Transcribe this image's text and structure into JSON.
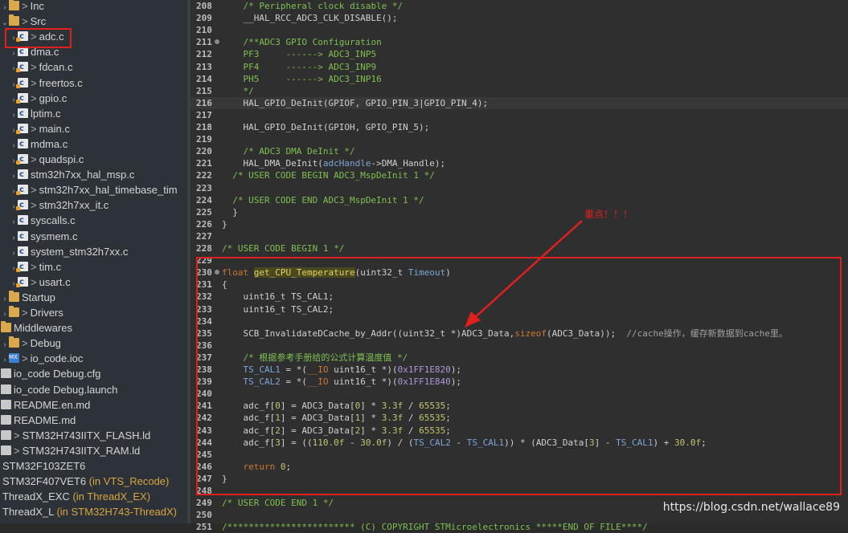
{
  "explorer": {
    "items": [
      {
        "chev": "›",
        "icon": "folder",
        "gt": true,
        "label": "Inc",
        "indent": 0
      },
      {
        "chev": "⌄",
        "icon": "folder",
        "gt": true,
        "label": "Src",
        "indent": 0
      },
      {
        "chev": "›",
        "icon": "cfile",
        "gt": true,
        "label": "adc.c",
        "indent": 1,
        "mod": true
      },
      {
        "chev": "›",
        "icon": "cfile",
        "gt": false,
        "label": "dma.c",
        "indent": 1
      },
      {
        "chev": "›",
        "icon": "cfile",
        "gt": true,
        "label": "fdcan.c",
        "indent": 1,
        "mod": true
      },
      {
        "chev": "›",
        "icon": "cfile",
        "gt": true,
        "label": "freertos.c",
        "indent": 1,
        "mod": true
      },
      {
        "chev": "›",
        "icon": "cfile",
        "gt": true,
        "label": "gpio.c",
        "indent": 1,
        "mod": true
      },
      {
        "chev": "›",
        "icon": "cfile",
        "gt": false,
        "label": "lptim.c",
        "indent": 1
      },
      {
        "chev": "›",
        "icon": "cfile",
        "gt": true,
        "label": "main.c",
        "indent": 1,
        "mod": true
      },
      {
        "chev": "›",
        "icon": "cfile",
        "gt": false,
        "label": "mdma.c",
        "indent": 1
      },
      {
        "chev": "›",
        "icon": "cfile",
        "gt": true,
        "label": "quadspi.c",
        "indent": 1,
        "mod": true
      },
      {
        "chev": "›",
        "icon": "cfile",
        "gt": false,
        "label": "stm32h7xx_hal_msp.c",
        "indent": 1
      },
      {
        "chev": "›",
        "icon": "cfile",
        "gt": true,
        "label": "stm32h7xx_hal_timebase_tim",
        "indent": 1,
        "mod": true
      },
      {
        "chev": "›",
        "icon": "cfile",
        "gt": true,
        "label": "stm32h7xx_it.c",
        "indent": 1,
        "mod": true
      },
      {
        "chev": "›",
        "icon": "cfile",
        "gt": false,
        "label": "syscalls.c",
        "indent": 1
      },
      {
        "chev": "›",
        "icon": "cfile",
        "gt": false,
        "label": "sysmem.c",
        "indent": 1
      },
      {
        "chev": "›",
        "icon": "cfile",
        "gt": false,
        "label": "system_stm32h7xx.c",
        "indent": 1
      },
      {
        "chev": "›",
        "icon": "cfile",
        "gt": true,
        "label": "tim.c",
        "indent": 1,
        "mod": true
      },
      {
        "chev": "›",
        "icon": "cfile",
        "gt": true,
        "label": "usart.c",
        "indent": 1,
        "mod": true
      },
      {
        "chev": "›",
        "icon": "folder",
        "gt": false,
        "label": "Startup",
        "indent": 0
      },
      {
        "chev": "›",
        "icon": "folder",
        "gt": true,
        "label": "Drivers",
        "indent": -1
      },
      {
        "chev": "",
        "icon": "folder",
        "gt": false,
        "label": "Middlewares",
        "indent": -2
      },
      {
        "chev": "›",
        "icon": "folder",
        "gt": true,
        "label": "Debug",
        "indent": -1
      },
      {
        "chev": "›",
        "icon": "mx",
        "gt": true,
        "label": "io_code.ioc",
        "indent": -1
      },
      {
        "chev": "",
        "icon": "doc",
        "gt": false,
        "label": "io_code Debug.cfg",
        "indent": -2
      },
      {
        "chev": "",
        "icon": "doc",
        "gt": false,
        "label": "io_code Debug.launch",
        "indent": -2
      },
      {
        "chev": "",
        "icon": "doc",
        "gt": false,
        "label": "README.en.md",
        "indent": -2
      },
      {
        "chev": "",
        "icon": "doc",
        "gt": false,
        "label": "README.md",
        "indent": -2
      },
      {
        "chev": "",
        "icon": "doc",
        "gt": true,
        "label": "STM32H743IITX_FLASH.ld",
        "indent": -2
      },
      {
        "chev": "",
        "icon": "doc",
        "gt": true,
        "label": "STM32H743IITX_RAM.ld",
        "indent": -2
      },
      {
        "chev": "",
        "icon": "",
        "gt": false,
        "label": "STM32F103ZET6",
        "indent": -3
      },
      {
        "chev": "",
        "icon": "",
        "gt": false,
        "label": "STM32F407VET6",
        "suffix": " (in VTS_Recode)",
        "indent": -3
      },
      {
        "chev": "",
        "icon": "",
        "gt": false,
        "label": "ThreadX_EXC",
        "suffix": " (in ThreadX_EX)",
        "indent": -3
      },
      {
        "chev": "",
        "icon": "",
        "gt": false,
        "label": "ThreadX_L",
        "suffix": " (in STM32H743-ThreadX)",
        "indent": -3
      }
    ]
  },
  "editor": {
    "lines": [
      {
        "n": "208",
        "t": [
          [
            "    ",
            ""
          ],
          [
            "/* Peripheral clock disable */",
            "cmt"
          ]
        ]
      },
      {
        "n": "209",
        "t": [
          [
            "    __HAL_RCC_ADC3_CLK_DISABLE();",
            ""
          ]
        ]
      },
      {
        "n": "210",
        "t": []
      },
      {
        "n": "211",
        "fold": true,
        "t": [
          [
            "    ",
            ""
          ],
          [
            "/**ADC3 GPIO Configuration",
            "cmt"
          ]
        ]
      },
      {
        "n": "212",
        "t": [
          [
            "    ",
            ""
          ],
          [
            "PF3     ------> ADC3_INP5",
            "cmt"
          ]
        ]
      },
      {
        "n": "213",
        "t": [
          [
            "    ",
            ""
          ],
          [
            "PF4     ------> ADC3_INP9",
            "cmt"
          ]
        ]
      },
      {
        "n": "214",
        "t": [
          [
            "    ",
            ""
          ],
          [
            "PH5     ------> ADC3_INP16",
            "cmt"
          ]
        ]
      },
      {
        "n": "215",
        "t": [
          [
            "    ",
            ""
          ],
          [
            "*/",
            "cmt"
          ]
        ]
      },
      {
        "n": "216",
        "current": true,
        "t": [
          [
            "    HAL_GPIO_DeInit(GPIOF, GPIO_PIN_3|GPIO_PIN_4);",
            ""
          ]
        ]
      },
      {
        "n": "217",
        "t": []
      },
      {
        "n": "218",
        "t": [
          [
            "    HAL_GPIO_DeInit(GPIOH, GPIO_PIN_5);",
            ""
          ]
        ]
      },
      {
        "n": "219",
        "t": []
      },
      {
        "n": "220",
        "t": [
          [
            "    ",
            ""
          ],
          [
            "/* ADC3 DMA DeInit */",
            "cmt"
          ]
        ]
      },
      {
        "n": "221",
        "t": [
          [
            "    HAL_DMA_DeInit(",
            ""
          ],
          [
            "adcHandle",
            "var"
          ],
          [
            "->DMA_Handle);",
            ""
          ]
        ]
      },
      {
        "n": "222",
        "t": [
          [
            "  ",
            ""
          ],
          [
            "/* USER CODE BEGIN ADC3_MspDeInit 1 */",
            "cmt"
          ]
        ]
      },
      {
        "n": "223",
        "t": []
      },
      {
        "n": "224",
        "t": [
          [
            "  ",
            ""
          ],
          [
            "/* USER CODE END ADC3_MspDeInit 1 */",
            "cmt"
          ]
        ]
      },
      {
        "n": "225",
        "t": [
          [
            "  }",
            ""
          ]
        ]
      },
      {
        "n": "226",
        "t": [
          [
            "}",
            ""
          ]
        ]
      },
      {
        "n": "227",
        "t": []
      },
      {
        "n": "228",
        "t": [
          [
            "/* USER CODE BEGIN 1 */",
            "cmt"
          ]
        ]
      },
      {
        "n": "229",
        "t": []
      },
      {
        "n": "230",
        "fold": true,
        "t": [
          [
            "float",
            "kw"
          ],
          [
            " ",
            ""
          ],
          [
            "get_CPU_Temperature",
            "fnhl"
          ],
          [
            "(uint32_t ",
            ""
          ],
          [
            "Timeout",
            "param"
          ],
          [
            ")",
            ""
          ]
        ]
      },
      {
        "n": "231",
        "t": [
          [
            "{",
            ""
          ]
        ]
      },
      {
        "n": "232",
        "t": [
          [
            "    uint16_t TS_CAL1;",
            ""
          ]
        ]
      },
      {
        "n": "233",
        "t": [
          [
            "    uint16_t TS_CAL2;",
            ""
          ]
        ]
      },
      {
        "n": "234",
        "t": []
      },
      {
        "n": "235",
        "t": [
          [
            "    SCB_InvalidateDCache_by_Addr((uint32_t *)ADC3_Data,",
            ""
          ],
          [
            "sizeof",
            "kw"
          ],
          [
            "(ADC3_Data));  ",
            ""
          ],
          [
            "//cache操作，缓存新数据到cache里。",
            "cn"
          ]
        ]
      },
      {
        "n": "236",
        "t": []
      },
      {
        "n": "237",
        "t": [
          [
            "    ",
            ""
          ],
          [
            "/* 根据参考手册给的公式计算温度值 */",
            "cmt"
          ]
        ]
      },
      {
        "n": "238",
        "t": [
          [
            "    ",
            ""
          ],
          [
            "TS_CAL1",
            "var"
          ],
          [
            " = *(",
            ""
          ],
          [
            "__IO",
            "kw"
          ],
          [
            " uint16_t *)(",
            ""
          ],
          [
            "0x1FF1E820",
            "hex"
          ],
          [
            ");",
            ""
          ]
        ]
      },
      {
        "n": "239",
        "t": [
          [
            "    ",
            ""
          ],
          [
            "TS_CAL2",
            "var"
          ],
          [
            " = *(",
            ""
          ],
          [
            "__IO",
            "kw"
          ],
          [
            " uint16_t *)(",
            ""
          ],
          [
            "0x1FF1E840",
            "hex"
          ],
          [
            ");",
            ""
          ]
        ]
      },
      {
        "n": "240",
        "t": []
      },
      {
        "n": "241",
        "t": [
          [
            "    adc_f[",
            ""
          ],
          [
            "0",
            "num"
          ],
          [
            "] = ADC3_Data[",
            ""
          ],
          [
            "0",
            "num"
          ],
          [
            "] * ",
            ""
          ],
          [
            "3.3f",
            "num"
          ],
          [
            " / ",
            ""
          ],
          [
            "65535",
            "num"
          ],
          [
            ";",
            ""
          ]
        ]
      },
      {
        "n": "242",
        "t": [
          [
            "    adc_f[",
            ""
          ],
          [
            "1",
            "num"
          ],
          [
            "] = ADC3_Data[",
            ""
          ],
          [
            "1",
            "num"
          ],
          [
            "] * ",
            ""
          ],
          [
            "3.3f",
            "num"
          ],
          [
            " / ",
            ""
          ],
          [
            "65535",
            "num"
          ],
          [
            ";",
            ""
          ]
        ]
      },
      {
        "n": "243",
        "t": [
          [
            "    adc_f[",
            ""
          ],
          [
            "2",
            "num"
          ],
          [
            "] = ADC3_Data[",
            ""
          ],
          [
            "2",
            "num"
          ],
          [
            "] * ",
            ""
          ],
          [
            "3.3f",
            "num"
          ],
          [
            " / ",
            ""
          ],
          [
            "65535",
            "num"
          ],
          [
            ";",
            ""
          ]
        ]
      },
      {
        "n": "244",
        "t": [
          [
            "    adc_f[",
            ""
          ],
          [
            "3",
            "num"
          ],
          [
            "] = ((",
            ""
          ],
          [
            "110.0f",
            "num"
          ],
          [
            " - ",
            ""
          ],
          [
            "30.0f",
            "num"
          ],
          [
            ") / (",
            ""
          ],
          [
            "TS_CAL2",
            "var"
          ],
          [
            " - ",
            ""
          ],
          [
            "TS_CAL1",
            "var"
          ],
          [
            ")) * (ADC3_Data[",
            ""
          ],
          [
            "3",
            "num"
          ],
          [
            "] - ",
            ""
          ],
          [
            "TS_CAL1",
            "var"
          ],
          [
            ") + ",
            ""
          ],
          [
            "30.0f",
            "num"
          ],
          [
            ";",
            ""
          ]
        ]
      },
      {
        "n": "245",
        "t": []
      },
      {
        "n": "246",
        "t": [
          [
            "    ",
            ""
          ],
          [
            "return",
            "kw"
          ],
          [
            " ",
            ""
          ],
          [
            "0",
            "num"
          ],
          [
            ";",
            ""
          ]
        ]
      },
      {
        "n": "247",
        "t": [
          [
            "}",
            ""
          ]
        ]
      },
      {
        "n": "248",
        "t": []
      },
      {
        "n": "249",
        "t": [
          [
            "/* USER CODE END 1 */",
            "cmt"
          ]
        ]
      },
      {
        "n": "250",
        "t": []
      },
      {
        "n": "251",
        "t": [
          [
            "/************************ (C) COPYRIGHT STMicroelectronics *****END OF FILE****/",
            "cmt"
          ]
        ]
      }
    ]
  },
  "annotation": {
    "text": "重点！！！",
    "color": "#e0201e"
  },
  "watermark": {
    "text": "https://blog.csdn.net/wallace89"
  },
  "colors": {
    "highlight_box": "#e0201e",
    "comment": "#7ec050",
    "keyword": "#cc7832",
    "variable": "#7ba6d8"
  }
}
